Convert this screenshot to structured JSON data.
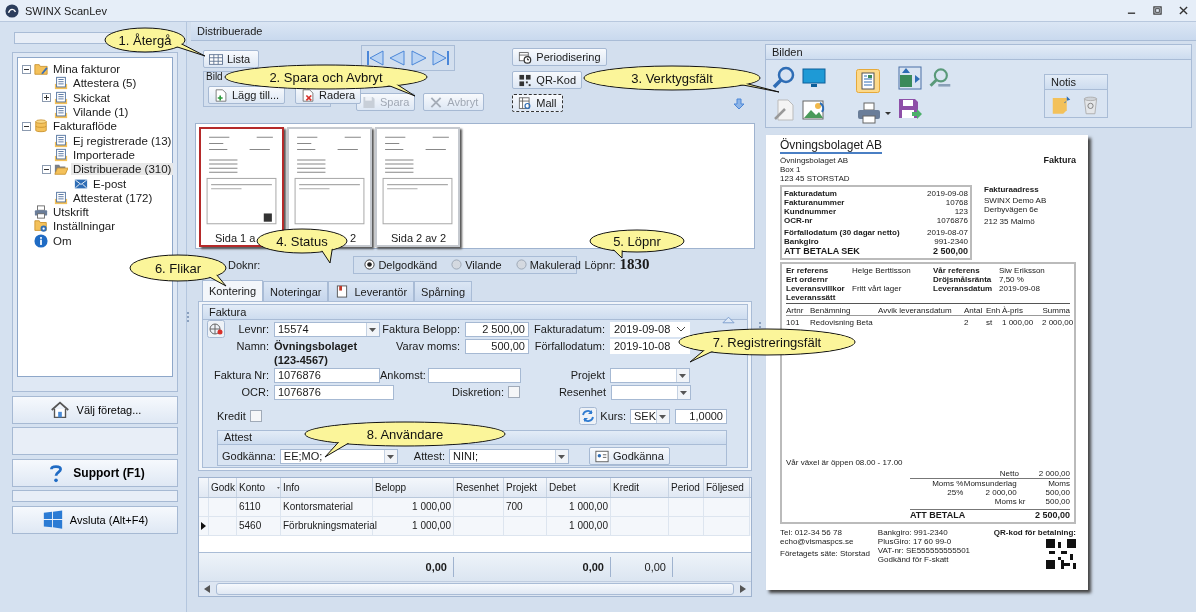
{
  "window": {
    "title": "SWINX ScanLev"
  },
  "sidebar": {
    "tree": [
      {
        "label": "Mina fakturor",
        "kind": "user-folder",
        "expanded": true,
        "selected": false,
        "children": [
          {
            "label": "Attestera (5)",
            "kind": "list",
            "selected": false
          },
          {
            "label": "Skickat",
            "kind": "list",
            "expanded": false,
            "selected": false
          },
          {
            "label": "Vilande (1)",
            "kind": "list",
            "selected": false
          }
        ]
      },
      {
        "label": "Fakturaflöde",
        "kind": "database",
        "expanded": true,
        "selected": false,
        "children": [
          {
            "label": "Ej registrerade (13)",
            "kind": "list",
            "selected": false
          },
          {
            "label": "Importerade",
            "kind": "list",
            "selected": false
          },
          {
            "label": "Distribuerade (310)",
            "kind": "open-folder",
            "expanded": true,
            "selected": true,
            "children": [
              {
                "label": "E-post",
                "kind": "mail",
                "selected": false
              }
            ]
          },
          {
            "label": "Attesterat (172)",
            "kind": "list",
            "selected": false
          }
        ]
      },
      {
        "label": "Utskrift",
        "kind": "printer",
        "selected": false
      },
      {
        "label": "Inställningar",
        "kind": "settings",
        "selected": false
      },
      {
        "label": "Om",
        "kind": "info",
        "selected": false
      }
    ],
    "buttons": [
      {
        "kind": "company",
        "label": "Välj företag..."
      },
      {
        "kind": "support",
        "label": "Support (F1)"
      },
      {
        "kind": "exit",
        "label": "Avsluta (Alt+F4)"
      }
    ]
  },
  "panel_title": "Distribuerade",
  "toolbar": {
    "list_button": "Lista",
    "images_group": "Bild",
    "add_button": "Lägg till...",
    "delete_button": "Radera",
    "save_button": {
      "label": "Spara",
      "disabled": true
    },
    "cancel_button": {
      "label": "Avbryt",
      "disabled": true
    },
    "period_button": "Periodisering",
    "qr_button": "QR-Kod",
    "template_button": "Mall"
  },
  "thumbnails": [
    {
      "label": "Sida 1 a",
      "selected": true
    },
    {
      "label": "2",
      "selected": false
    },
    {
      "label": "Sida 2 av 2",
      "selected": false
    }
  ],
  "document_status": {
    "doknr_label": "Doknr:",
    "options": [
      {
        "label": "Delgodkänd",
        "selected": true
      },
      {
        "label": "Vilande",
        "selected": false
      },
      {
        "label": "Makulerad",
        "selected": false
      }
    ],
    "lopnr_label": "Löpnr:",
    "lopnr": "1830"
  },
  "tabs": [
    {
      "label": "Kontering",
      "selected": true
    },
    {
      "label": "Noteringar",
      "selected": false
    },
    {
      "label": "Leverantör",
      "selected": false,
      "has_icon": true
    },
    {
      "label": "Spårning",
      "selected": false
    }
  ],
  "invoice_form": {
    "title": "Faktura",
    "levnr": {
      "label": "Levnr:",
      "value": "15574"
    },
    "namn": {
      "label": "Namn:",
      "value": "Övningsbolaget",
      "value_line_2": "(123-4567)"
    },
    "faktura_belopp": {
      "label": "Faktura Belopp:",
      "value": "2 500,00"
    },
    "varav_moms": {
      "label": "Varav moms:",
      "value": "500,00"
    },
    "fakturadatum": {
      "label": "Fakturadatum:",
      "value": "2019-09-08"
    },
    "forfallodatum": {
      "label": "Förfallodatum:",
      "value": "2019-10-08"
    },
    "faktura_nr": {
      "label": "Faktura Nr:",
      "value": "1076876"
    },
    "ocr": {
      "label": "OCR:",
      "value": "1076876"
    },
    "ankomst": {
      "label": "Ankomst:"
    },
    "diskretion": {
      "label": "Diskretion:",
      "checked": false
    },
    "projekt": {
      "label": "Projekt"
    },
    "resenhet": {
      "label": "Resenhet"
    },
    "kredit": {
      "label": "Kredit",
      "checked": false
    },
    "kurs": {
      "label": "Kurs:",
      "currency": "SEK",
      "rate": "1,0000"
    },
    "attest": {
      "title": "Attest",
      "godkanna_label": "Godkänna:",
      "godkanna_value": "EE;MO;",
      "attest_label": "Attest:",
      "attest_value": "NINI;",
      "approve_button": "Godkänna"
    }
  },
  "account_grid": {
    "columns": [
      "Godk",
      "Konto",
      "Info",
      "Belopp",
      "Resenhet",
      "Projekt",
      "Debet",
      "Kredit",
      "Period",
      "Följesed"
    ],
    "rows": [
      {
        "current": false,
        "konto": "6110",
        "info": "Kontorsmaterial",
        "belopp": "1 000,00",
        "projekt": "700",
        "debet": "1 000,00"
      },
      {
        "current": true,
        "konto": "5460",
        "info": "Förbrukningsmaterial",
        "belopp": "1 000,00",
        "debet": "1 000,00"
      }
    ],
    "totals": {
      "belopp": "0,00",
      "debet": "0,00",
      "kredit": "0,00"
    }
  },
  "image_panel": {
    "title": "Bilden",
    "notes_group": "Notis"
  },
  "document": {
    "logo": "Övningsbolaget AB",
    "title": "Faktura",
    "sender": [
      "Övningsbolaget AB",
      "Box 1",
      "123 45  STORSTAD"
    ],
    "address_label": "Fakturaadress",
    "address": [
      "SWINX Demo AB",
      "Derbyvägen 6e",
      "212 35  Malmö"
    ],
    "info": [
      {
        "label": "Fakturadatum",
        "value": "2019-09-08"
      },
      {
        "label": "Fakturanummer",
        "value": "10768"
      },
      {
        "label": "Kundnummer",
        "value": "123"
      },
      {
        "label": "OCR-nr",
        "value": "1076876"
      },
      {
        "label": "Förfallodatum (30 dagar netto)",
        "value": "2019-08-07"
      },
      {
        "label": "Bankgiro",
        "value": "991-2340"
      }
    ],
    "info_total": {
      "label": "ATT BETALA SEK",
      "value": "2 500,00"
    },
    "references": [
      {
        "label": "Er referens",
        "value": "Helge Berttisson"
      },
      {
        "label": "Ert ordernr"
      },
      {
        "label": "Leveransvillkor",
        "value": "Fritt vårt lager"
      },
      {
        "label": "Leveranssätt"
      }
    ],
    "references_right": [
      {
        "label": "Vår referens",
        "value": "Siw Eriksson"
      },
      {
        "label": "Dröjsmålsränta",
        "value": "7,50 %"
      },
      {
        "label": "Leveransdatum",
        "value": "2019-09-08"
      }
    ],
    "lines_columns": [
      "Artnr",
      "Benämning",
      "Avvik leveransdatum",
      "Antal",
      "Enh",
      "À-pris",
      "Summa"
    ],
    "lines": [
      {
        "artnr": "101",
        "benamning": "Redovisning Beta",
        "antal": "2",
        "enh": "st",
        "a_pris": "1 000,00",
        "summa": "2 000,00"
      }
    ],
    "opening_hours": "Vår växel är öppen 08.00 - 17.00",
    "netto": {
      "label": "Netto",
      "value": "2 000,00"
    },
    "vat_columns": [
      "Moms %",
      "Momsunderlag",
      "Moms"
    ],
    "vat_row": [
      "25%",
      "2 000,00",
      "500,00"
    ],
    "vat_total": {
      "label": "Moms kr",
      "value": "500,00"
    },
    "total": {
      "label": "ATT BETALA",
      "value": "2 500,00"
    },
    "footer": [
      [
        "Tel: 012-34 56 78",
        "echo@vismaspcs.se",
        "Företagets säte: Storstad"
      ],
      [
        "Bankgiro: 991-2340",
        "PlusGiro: 17 60 99-0",
        "VAT-nr: SE555555555501",
        "Godkänd för F-skatt"
      ]
    ],
    "qr_label": "QR-kod för betalning:"
  },
  "annotations": [
    "1. Återgå",
    "2. Spara och Avbryt",
    "3. Verktygsfält",
    "4. Status",
    "5. Löpnr",
    "6. Flikar",
    "7. Registreringsfält",
    "8. Användare"
  ]
}
